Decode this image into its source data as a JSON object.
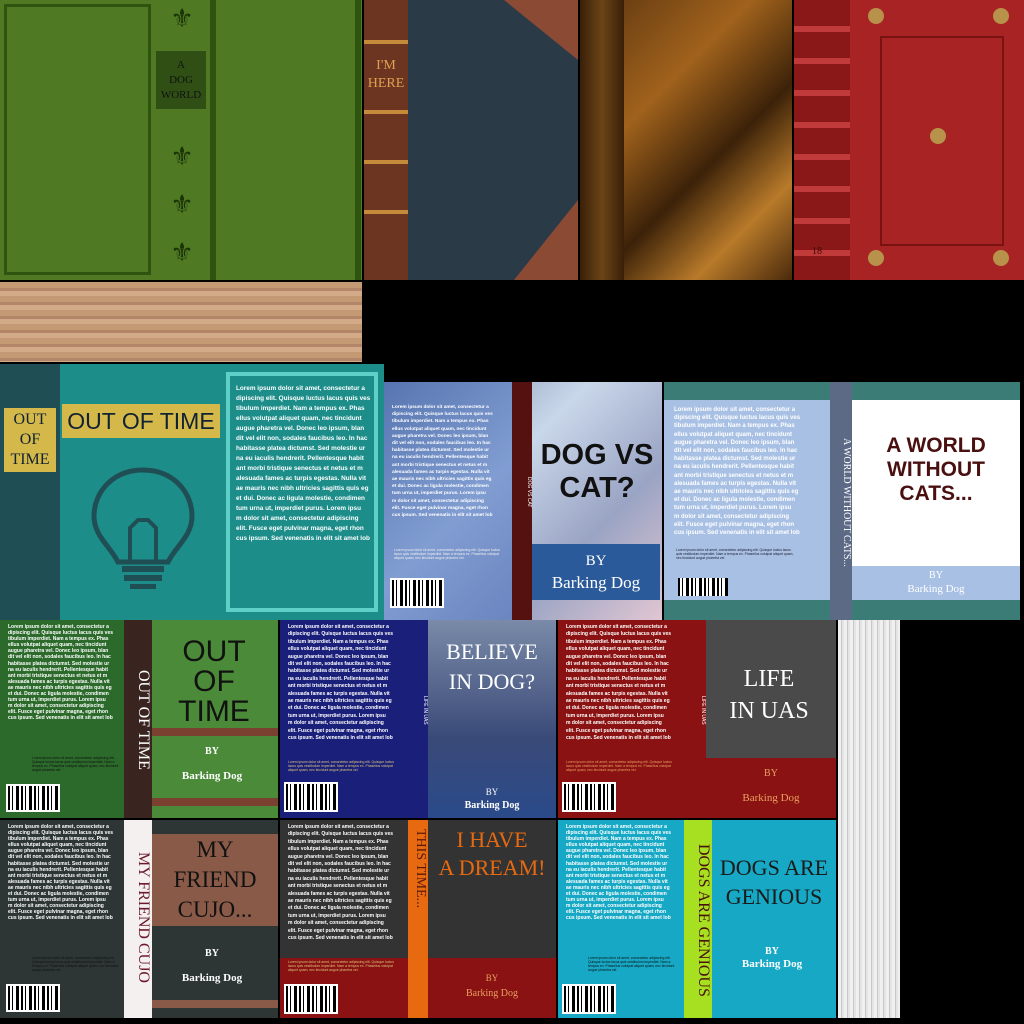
{
  "atlas": {
    "green_book_title": "A\nDOG\nWORLD",
    "spine_title": "I'M\nHERE",
    "red_book_number": "18",
    "lorem": "Lorem ipsum dolor sit amet, consectetur a\ndipiscing elit. Quisque luctus lacus quis ves\ntibulum imperdiet. Nam a tempus ex. Phas\nellus volutpat aliquet quam, nec tincidunt\n augue pharetra vel. Donec leo ipsum, blan\ndit vel elit non, sodales faucibus leo. In hac\nhabitasse platea dictumst. Sed molestie ur\nna eu iaculis hendrerit. Pellentesque habit\nant morbi tristique senectus et netus et m\nalesuada fames ac turpis egestas. Nulla vit\nae mauris nec nibh ultricies sagittis quis eg\net dui. Donec ac ligula molestie, condimen\ntum urna ut, imperdiet purus. Lorem ipsu\nm dolor sit amet, consectetur adipiscing\nelit. Fusce eget pulvinar magna, eget rhon\ncus ipsum. Sed venenatis in elit sit amet lob",
    "small_print": "Lorem ipsum dolor sit amet, consectetur adipiscing elit. Quisque luctus lacus quis vestibulum imperdiet. Nam a tempus ex. Phasellus volutpat aliquet quam, nec tincidunt augue pharetra vel.",
    "author_by": "BY",
    "author_name": "Barking Dog",
    "covers": {
      "out_of_time_a": {
        "spine": "OUT\nOF\nTIME",
        "title": "OUT OF TIME"
      },
      "dog_vs_cat": {
        "spine": "DOG VS CAT",
        "title": "DOG VS\nCAT?"
      },
      "world_without_cats": {
        "spine": "A WORLD WITHOUT CATS...",
        "title": "A WORLD\nWITHOUT\nCATS..."
      },
      "out_of_time_b": {
        "spine": "OUT OF TIME",
        "title": "OUT\nOF\nTIME"
      },
      "believe_in_dog": {
        "spine": "LIFE IN UAS",
        "title": "BELIEVE\nIN DOG?"
      },
      "life_in_uas": {
        "spine": "LIFE IN UAS",
        "title": "LIFE\nIN UAS"
      },
      "my_friend_cujo": {
        "spine": "MY FRIEND CUJO",
        "title": "MY\nFRIEND\nCUJO..."
      },
      "i_have_a_dream": {
        "spine": "THIS TIME...",
        "title": "I HAVE\nA DREAM!"
      },
      "dogs_are_genious": {
        "spine": "DOGS ARE GENIOUS",
        "title": "DOGS ARE\nGENIOUS"
      }
    }
  }
}
